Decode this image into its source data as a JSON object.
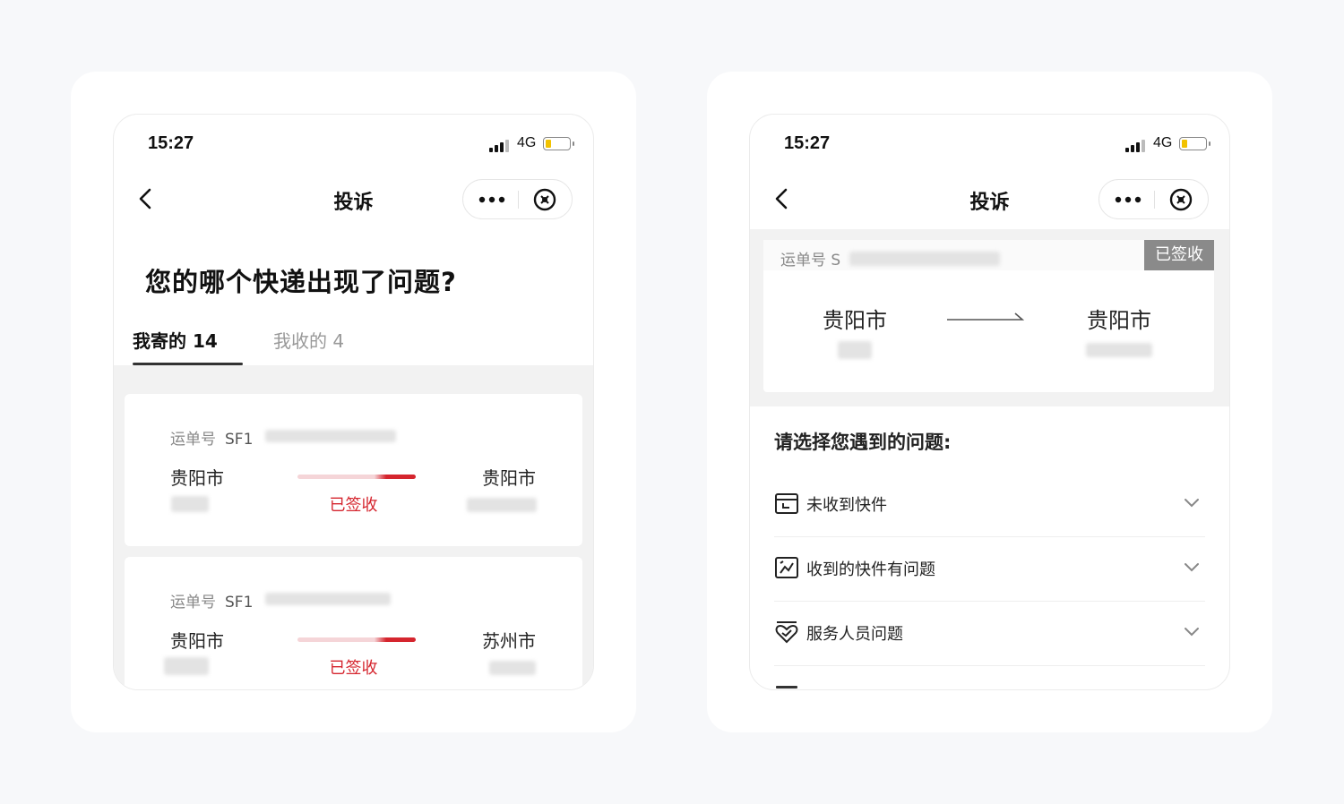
{
  "screens": [
    {
      "status": {
        "time": "15:27",
        "network": "4G"
      },
      "nav": {
        "title": "投诉"
      },
      "question": "您的哪个快递出现了问题?",
      "tabs": [
        {
          "label": "我寄的 14",
          "active": true
        },
        {
          "label": "我收的 4",
          "active": false
        }
      ],
      "orders": [
        {
          "waybill_label": "运单号",
          "waybill_prefix": "SF1",
          "from_city": "贵阳市",
          "to_city": "贵阳市",
          "status": "已签收"
        },
        {
          "waybill_label": "运单号",
          "waybill_prefix": "SF1",
          "from_city": "贵阳市",
          "to_city": "苏州市",
          "status": "已签收"
        }
      ]
    },
    {
      "status": {
        "time": "15:27",
        "network": "4G"
      },
      "nav": {
        "title": "投诉"
      },
      "shipment": {
        "waybill_label": "运单号",
        "waybill_prefix": "S",
        "status_badge": "已签收",
        "from_city": "贵阳市",
        "to_city": "贵阳市"
      },
      "section_title": "请选择您遇到的问题:",
      "issues": [
        {
          "label": "未收到快件",
          "icon": "box-icon"
        },
        {
          "label": "收到的快件有问题",
          "icon": "broken-package-icon"
        },
        {
          "label": "服务人员问题",
          "icon": "heart-service-icon"
        }
      ]
    }
  ],
  "colors": {
    "accent_red": "#d5252e",
    "badge_gray": "#8a8a8a",
    "battery_yellow": "#f2c200"
  }
}
